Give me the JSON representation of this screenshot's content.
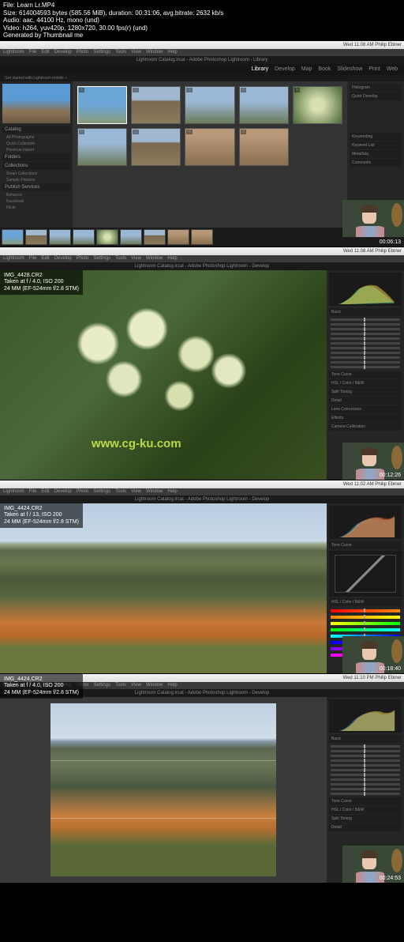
{
  "meta": {
    "l1": "File: Learn Lr.MP4",
    "l2": "Size: 614004593 bytes (585.56 MiB), duration: 00:31:06, avg.bitrate: 2632 kb/s",
    "l3": "Audio: aac, 44100 Hz, mono (und)",
    "l4": "Video: h264, yuv420p, 1280x720, 30.00 fps(r) (und)",
    "l5": "Generated by Thumbnail me"
  },
  "macbar": "Wed 11:08 AM  Philip Ebiner",
  "macbar2": "Wed 11:08 AM  Philip Ebiner",
  "macbar3": "Wed 11:02 AM  Philip Ebiner",
  "macbar4": "Wed 11:10 PM  Philip Ebiner",
  "appmenu": [
    "Lightroom",
    "File",
    "Edit",
    "Develop",
    "Photo",
    "Settings",
    "Tools",
    "View",
    "Window",
    "Help"
  ],
  "tabtitle": "Lightroom Catalog.lrcat - Adobe Photoshop Lightroom - Library",
  "tabtitle2": "Lightroom Catalog.lrcat - Adobe Photoshop Lightroom - Develop",
  "modules": [
    "Library",
    "Develop",
    "Map",
    "Book",
    "Slideshow",
    "Print",
    "Web"
  ],
  "subtitle": "Get started with Lightroom mobile »",
  "lp": {
    "catalog": "Catalog",
    "folders": "Folders",
    "collections": "Collections",
    "publish": "Publish Services"
  },
  "lpitems": [
    "All Photographs",
    "Quick Collection",
    "Previous Import",
    "Smart Collections",
    "Sample Pictures",
    "Behance",
    "Facebook",
    "Flickr"
  ],
  "rp": {
    "histogram": "Histogram",
    "quickdev": "Quick Develop",
    "keywording": "Keywording",
    "keywordlist": "Keyword List",
    "metadata": "Metadata",
    "comments": "Comments"
  },
  "img1": {
    "name": "IMG_4428.CR2",
    "exif": "Taken at f / 4.0, ISO 200",
    "lens": "24 MM (EF-524mm f/2.8 STM)"
  },
  "img2": {
    "name": "IMG_4424.CR2",
    "exif": "Taken at f / 13, ISO 200",
    "lens": "24 MM (EF-524mm f/2.8 STM)"
  },
  "img3": {
    "name": "IMG_4424.CR2",
    "exif": "Taken at f / 4.0, ISO 200",
    "lens": "24 MM (EF-524mm f/2.8 STM)"
  },
  "dp": {
    "basic": "Basic",
    "tonecurve": "Tone Curve",
    "hsl": "HSL / Color / B&W",
    "split": "Split Toning",
    "detail": "Detail",
    "lens": "Lens Corrections",
    "effects": "Effects",
    "camera": "Camera Calibration"
  },
  "ts": {
    "f1": "00:06:13",
    "f2": "00:12:26",
    "f3": "00:18:40",
    "f4": "00:24:53"
  },
  "watermark": "www.cg-ku.com"
}
